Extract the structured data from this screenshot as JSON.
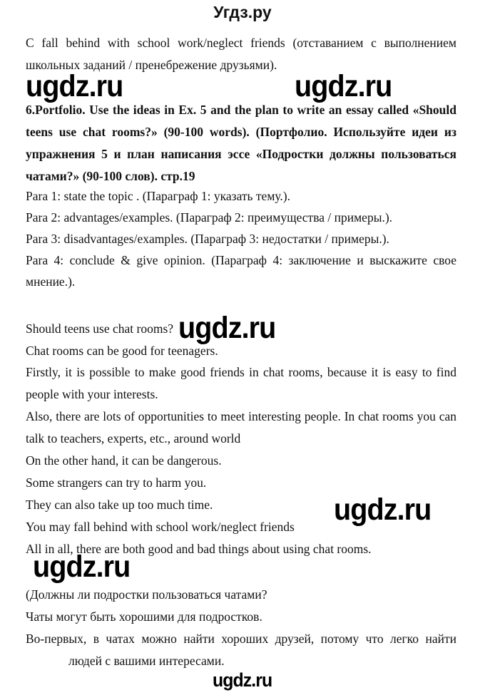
{
  "header": {
    "site_title": "Угдз.ру"
  },
  "watermark": "ugdz.ru",
  "intro": {
    "line1": "C fall behind with school work/neglect friends (отставанием с выполнением",
    "line2": "школьных заданий / пренебрежение друзьями)."
  },
  "task": {
    "lines": [
      "6.Portfolio. Use the ideas in Ex. 5 and the plan to write an essay called «Should",
      "teens use chat rooms?» (90-100 words). (Портфолио. Используйте идеи из",
      "упражнения 5 и план написания эссе «Подростки должны пользоваться",
      "чатами?» (90-100 слов). стр.19"
    ]
  },
  "plan": {
    "lines": [
      "Para 1: state the topic . (Параграф 1: указать тему.).",
      "Para 2: advantages/examples. (Параграф 2: преимущества / примеры.).",
      "Para 3: disadvantages/examples. (Параграф 3: недостатки / примеры.).",
      "Para 4: conclude & give opinion. (Параграф 4: заключение и выскажите свое",
      "мнение.)."
    ]
  },
  "essay": {
    "lines": [
      "Should teens use chat rooms?",
      "Chat rooms can be good for teenagers.",
      "Firstly, it is possible to make good friends in chat rooms, because it is easy to find",
      "people with your interests.",
      "Also, there are lots of opportunities to meet interesting people. In chat rooms you can",
      "talk to teachers, experts, etc., around world",
      "On the other hand, it can be dangerous.",
      "Some strangers can try to harm you.",
      "They can also take up too much time.",
      "You may fall behind with school work/neglect friends",
      "All in all, there are both good and bad things about using chat rooms."
    ]
  },
  "translation": {
    "lines": [
      "(Должны ли подростки пользоваться чатами?",
      "Чаты могут быть хорошими для подростков.",
      "Во-первых, в чатах можно найти хороших друзей, потому что легко найти",
      "людей с вашими интересами."
    ]
  }
}
